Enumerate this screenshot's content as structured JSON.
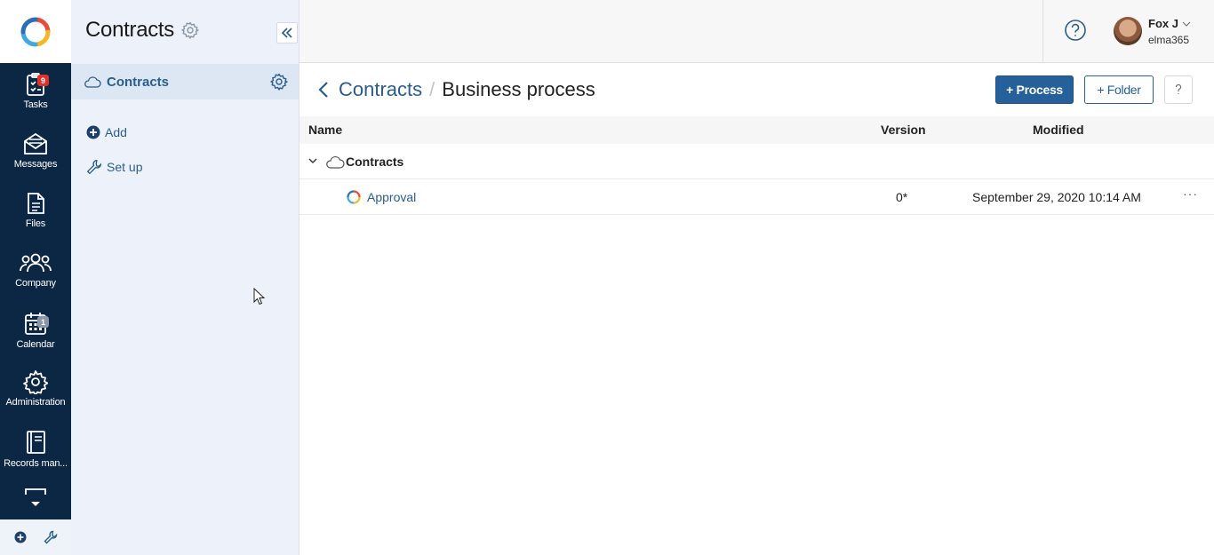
{
  "app": {
    "module_title": "Contracts"
  },
  "rail": {
    "items": [
      {
        "label": "Tasks",
        "icon": "tasks-icon",
        "badge": "9"
      },
      {
        "label": "Messages",
        "icon": "messages-icon",
        "badge": ""
      },
      {
        "label": "Files",
        "icon": "files-icon",
        "badge": ""
      },
      {
        "label": "Company",
        "icon": "company-icon",
        "badge": ""
      },
      {
        "label": "Calendar",
        "icon": "calendar-icon",
        "badge": "1"
      },
      {
        "label": "Administration",
        "icon": "gear-icon",
        "badge": ""
      },
      {
        "label": "Records man...",
        "icon": "records-icon",
        "badge": ""
      }
    ]
  },
  "sidebar": {
    "active_item": "Contracts",
    "links": [
      {
        "label": "Add",
        "icon": "plus-circle-icon"
      },
      {
        "label": "Set up",
        "icon": "wrench-icon"
      }
    ]
  },
  "user": {
    "name": "Fox J",
    "org": "elma365"
  },
  "breadcrumb": {
    "parent": "Contracts",
    "separator": "/",
    "current": "Business process"
  },
  "toolbar": {
    "process_label": "+ Process",
    "folder_label": "+ Folder"
  },
  "table": {
    "columns": {
      "name": "Name",
      "version": "Version",
      "modified": "Modified"
    },
    "group": {
      "label": "Contracts"
    },
    "rows": [
      {
        "name": "Approval",
        "version": "0*",
        "modified": "September 29, 2020 10:14 AM",
        "more": "···"
      }
    ]
  },
  "colors": {
    "rail_bg": "#0c2743",
    "sidebar_bg": "#edf2fa",
    "accent": "#25609a",
    "badge_red": "#e0322b"
  }
}
